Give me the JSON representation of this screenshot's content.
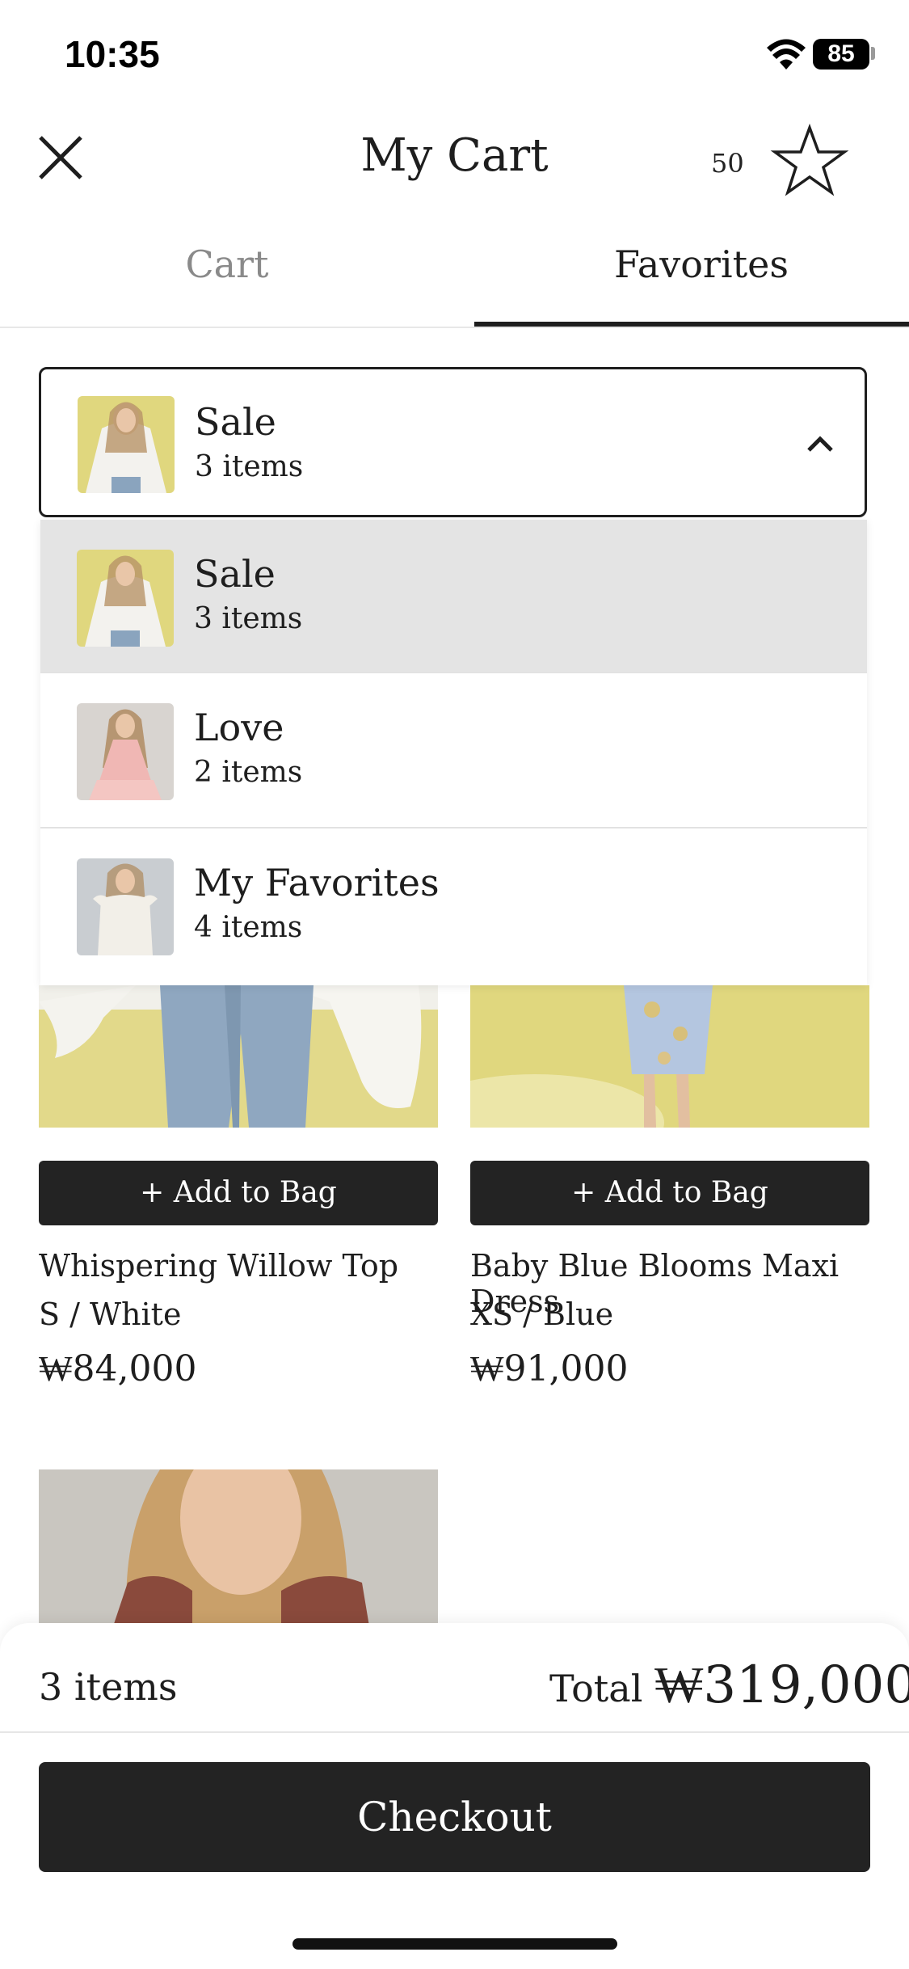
{
  "status_bar": {
    "time": "10:35",
    "battery": "85"
  },
  "header": {
    "title": "My Cart",
    "favorites_count": "50"
  },
  "tabs": [
    {
      "label": "Cart",
      "active": false
    },
    {
      "label": "Favorites",
      "active": true
    }
  ],
  "dropdown": {
    "selected": {
      "title": "Sale",
      "count": "3 items"
    },
    "options": [
      {
        "title": "Sale",
        "count": "3 items",
        "selected": true
      },
      {
        "title": "Love",
        "count": "2 items",
        "selected": false
      },
      {
        "title": "My Favorites",
        "count": "4 items",
        "selected": false
      }
    ]
  },
  "products": [
    {
      "add_label": "+ Add to Bag",
      "name": "Whispering Willow Top",
      "variant": "S / White",
      "price": "₩84,000"
    },
    {
      "add_label": "+ Add to Bag",
      "name": "Baby Blue Blooms Maxi Dress",
      "variant": "XS / Blue",
      "price": "₩91,000"
    }
  ],
  "footer": {
    "items_count": "3 items",
    "total_label": "Total",
    "total_value": "₩319,000",
    "checkout_label": "Checkout"
  },
  "colors": {
    "dark": "#232323",
    "accent_bg": "#e0d77e",
    "selected_option": "#e4e4e4"
  }
}
